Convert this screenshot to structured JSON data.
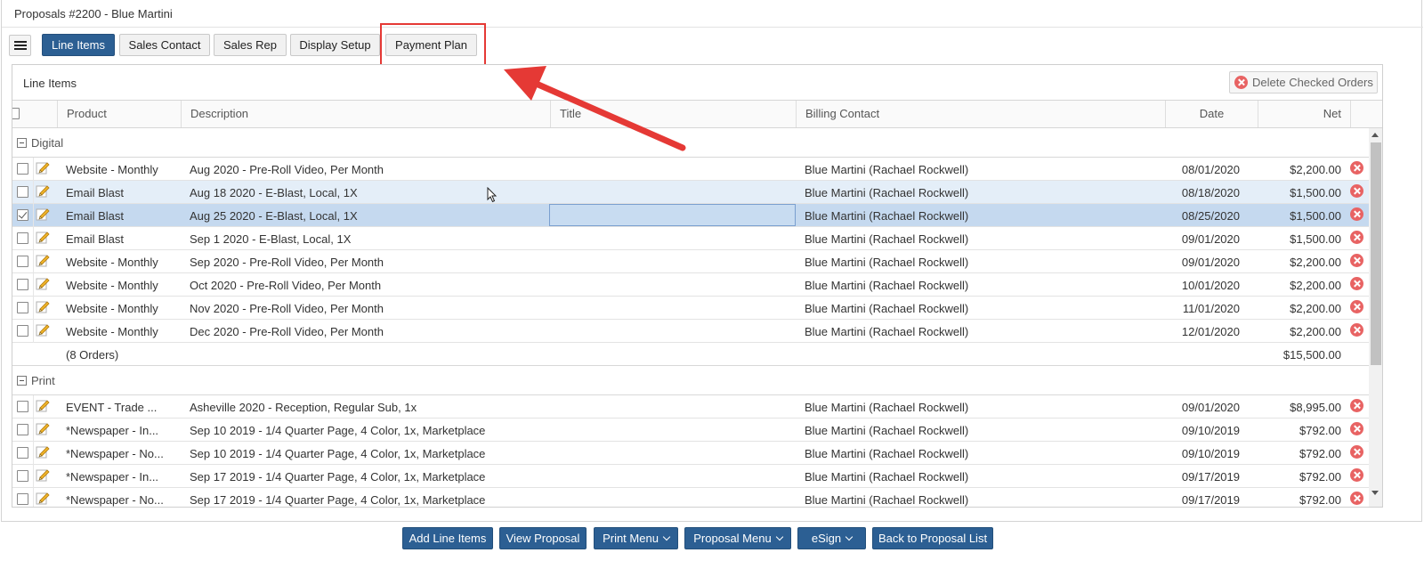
{
  "window": {
    "title": "Proposals #2200 - Blue Martini"
  },
  "tabs": [
    {
      "label": "Line Items",
      "active": true
    },
    {
      "label": "Sales Contact",
      "active": false
    },
    {
      "label": "Sales Rep",
      "active": false
    },
    {
      "label": "Display Setup",
      "active": false
    },
    {
      "label": "Payment Plan",
      "active": false
    }
  ],
  "panel": {
    "title": "Line Items",
    "delete_label": "Delete Checked Orders"
  },
  "columns": [
    "Product",
    "Description",
    "Title",
    "Billing Contact",
    "Date",
    "Net"
  ],
  "groups": [
    {
      "name": "Digital",
      "rows": [
        {
          "product": "Website - Monthly",
          "description": "Aug 2020 - Pre-Roll Video, Per Month",
          "title": "",
          "billing": "Blue Martini (Rachael Rockwell)",
          "date": "08/01/2020",
          "net": "$2,200.00",
          "checked": false,
          "state": "normal"
        },
        {
          "product": "Email Blast",
          "description": "Aug 18 2020 - E-Blast, Local, 1X",
          "title": "",
          "billing": "Blue Martini (Rachael Rockwell)",
          "date": "08/18/2020",
          "net": "$1,500.00",
          "checked": false,
          "state": "hover"
        },
        {
          "product": "Email Blast",
          "description": "Aug 25 2020 - E-Blast, Local, 1X",
          "title": "",
          "billing": "Blue Martini (Rachael Rockwell)",
          "date": "08/25/2020",
          "net": "$1,500.00",
          "checked": true,
          "state": "selected"
        },
        {
          "product": "Email Blast",
          "description": "Sep 1 2020 - E-Blast, Local, 1X",
          "title": "",
          "billing": "Blue Martini (Rachael Rockwell)",
          "date": "09/01/2020",
          "net": "$1,500.00",
          "checked": false,
          "state": "normal"
        },
        {
          "product": "Website - Monthly",
          "description": "Sep 2020 - Pre-Roll Video, Per Month",
          "title": "",
          "billing": "Blue Martini (Rachael Rockwell)",
          "date": "09/01/2020",
          "net": "$2,200.00",
          "checked": false,
          "state": "normal"
        },
        {
          "product": "Website - Monthly",
          "description": "Oct 2020 - Pre-Roll Video, Per Month",
          "title": "",
          "billing": "Blue Martini (Rachael Rockwell)",
          "date": "10/01/2020",
          "net": "$2,200.00",
          "checked": false,
          "state": "normal"
        },
        {
          "product": "Website - Monthly",
          "description": "Nov 2020 - Pre-Roll Video, Per Month",
          "title": "",
          "billing": "Blue Martini (Rachael Rockwell)",
          "date": "11/01/2020",
          "net": "$2,200.00",
          "checked": false,
          "state": "normal"
        },
        {
          "product": "Website - Monthly",
          "description": "Dec 2020 - Pre-Roll Video, Per Month",
          "title": "",
          "billing": "Blue Martini (Rachael Rockwell)",
          "date": "12/01/2020",
          "net": "$2,200.00",
          "checked": false,
          "state": "normal"
        }
      ],
      "summary_count": "(8 Orders)",
      "summary_total": "$15,500.00"
    },
    {
      "name": "Print",
      "rows": [
        {
          "product": "EVENT - Trade ...",
          "description": "Asheville 2020 - Reception, Regular Sub, 1x",
          "title": "",
          "billing": "Blue Martini (Rachael Rockwell)",
          "date": "09/01/2020",
          "net": "$8,995.00",
          "checked": false,
          "state": "normal"
        },
        {
          "product": "*Newspaper - In...",
          "description": "Sep 10 2019 - 1/4 Quarter Page, 4 Color, 1x, Marketplace",
          "title": "",
          "billing": "Blue Martini (Rachael Rockwell)",
          "date": "09/10/2019",
          "net": "$792.00",
          "checked": false,
          "state": "normal"
        },
        {
          "product": "*Newspaper - No...",
          "description": "Sep 10 2019 - 1/4 Quarter Page, 4 Color, 1x, Marketplace",
          "title": "",
          "billing": "Blue Martini (Rachael Rockwell)",
          "date": "09/10/2019",
          "net": "$792.00",
          "checked": false,
          "state": "normal"
        },
        {
          "product": "*Newspaper - In...",
          "description": "Sep 17 2019 - 1/4 Quarter Page, 4 Color, 1x, Marketplace",
          "title": "",
          "billing": "Blue Martini (Rachael Rockwell)",
          "date": "09/17/2019",
          "net": "$792.00",
          "checked": false,
          "state": "normal"
        },
        {
          "product": "*Newspaper - No...",
          "description": "Sep 17 2019 - 1/4 Quarter Page, 4 Color, 1x, Marketplace",
          "title": "",
          "billing": "Blue Martini (Rachael Rockwell)",
          "date": "09/17/2019",
          "net": "$792.00",
          "checked": false,
          "state": "normal"
        }
      ]
    }
  ],
  "footer": [
    {
      "label": "Add Line Items",
      "dropdown": false
    },
    {
      "label": "View Proposal",
      "dropdown": false
    },
    {
      "label": "Print Menu",
      "dropdown": true
    },
    {
      "label": "Proposal Menu",
      "dropdown": true
    },
    {
      "label": "eSign",
      "dropdown": true
    },
    {
      "label": "Back to Proposal List",
      "dropdown": false
    }
  ],
  "colors": {
    "primary": "#2c5f93",
    "row_hover": "#e4eef8",
    "row_selected": "#c5d9ef",
    "annotation": "#e53935",
    "remove": "#e86363"
  },
  "icons": {
    "menu": "hamburger-icon",
    "edit": "pencil-icon",
    "remove": "remove-icon",
    "group_toggle": "collapse-icon"
  }
}
